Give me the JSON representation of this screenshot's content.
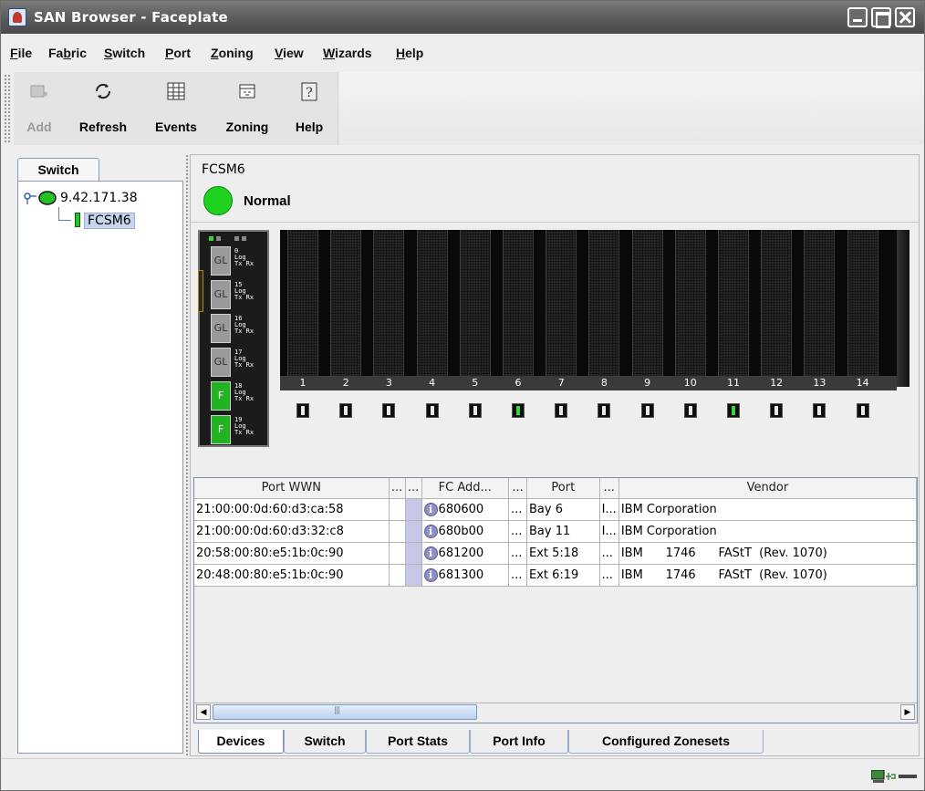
{
  "window": {
    "title": "SAN Browser - Faceplate"
  },
  "menu": [
    {
      "label": "File",
      "mnemonic": "F"
    },
    {
      "label": "Fabric",
      "mnemonic": "b"
    },
    {
      "label": "Switch",
      "mnemonic": "S"
    },
    {
      "label": "Port",
      "mnemonic": "P"
    },
    {
      "label": "Zoning",
      "mnemonic": "Z"
    },
    {
      "label": "View",
      "mnemonic": "V"
    },
    {
      "label": "Wizards",
      "mnemonic": "W"
    },
    {
      "label": "Help",
      "mnemonic": "H"
    }
  ],
  "toolbar": {
    "add_label": "Add",
    "refresh_label": "Refresh",
    "events_label": "Events",
    "zoning_label": "Zoning",
    "help_label": "Help"
  },
  "left_panel": {
    "tab_label": "Switch",
    "tree_root": "9.42.171.38",
    "tree_child": "FCSM6"
  },
  "switch": {
    "name": "FCSM6",
    "status": "Normal",
    "status_color": "#1fd21f"
  },
  "external_module": {
    "ports": [
      {
        "type": "GL",
        "number": "0",
        "active": false
      },
      {
        "type": "GL",
        "number": "15",
        "active": false
      },
      {
        "type": "GL",
        "number": "16",
        "active": false
      },
      {
        "type": "GL",
        "number": "17",
        "active": false
      },
      {
        "type": "F",
        "number": "18",
        "active": true
      },
      {
        "type": "F",
        "number": "19",
        "active": true
      }
    ],
    "port_led_label": "Log",
    "port_txrx_label": "Tx Rx"
  },
  "bays": [
    {
      "number": "1",
      "active": false
    },
    {
      "number": "2",
      "active": false
    },
    {
      "number": "3",
      "active": false
    },
    {
      "number": "4",
      "active": false
    },
    {
      "number": "5",
      "active": false
    },
    {
      "number": "6",
      "active": true
    },
    {
      "number": "7",
      "active": false
    },
    {
      "number": "8",
      "active": false
    },
    {
      "number": "9",
      "active": false
    },
    {
      "number": "10",
      "active": false
    },
    {
      "number": "11",
      "active": true
    },
    {
      "number": "12",
      "active": false
    },
    {
      "number": "13",
      "active": false
    },
    {
      "number": "14",
      "active": false
    }
  ],
  "devices_table": {
    "columns": [
      "Port WWN",
      "...",
      "...",
      "FC Add...",
      "...",
      "Port",
      "...",
      "Vendor"
    ],
    "rows": [
      [
        "21:00:00:0d:60:d3:ca:58",
        "",
        "",
        "680600",
        "...",
        "Bay 6",
        "I...",
        "IBM Corporation"
      ],
      [
        "21:00:00:0d:60:d3:32:c8",
        "",
        "",
        "680b00",
        "...",
        "Bay 11",
        "I...",
        "IBM Corporation"
      ],
      [
        "20:58:00:80:e5:1b:0c:90",
        "",
        "",
        "681200",
        "...",
        "Ext 5:18",
        "...",
        "IBM      1746      FAStT  (Rev. 1070)"
      ],
      [
        "20:48:00:80:e5:1b:0c:90",
        "",
        "",
        "681300",
        "...",
        "Ext 6:19",
        "...",
        "IBM      1746      FAStT  (Rev. 1070)"
      ]
    ]
  },
  "bottom_tabs": [
    {
      "label": "Devices",
      "active": true
    },
    {
      "label": "Switch",
      "active": false
    },
    {
      "label": "Port Stats",
      "active": false
    },
    {
      "label": "Port Info",
      "active": false
    },
    {
      "label": "Configured Zonesets",
      "active": false
    }
  ]
}
